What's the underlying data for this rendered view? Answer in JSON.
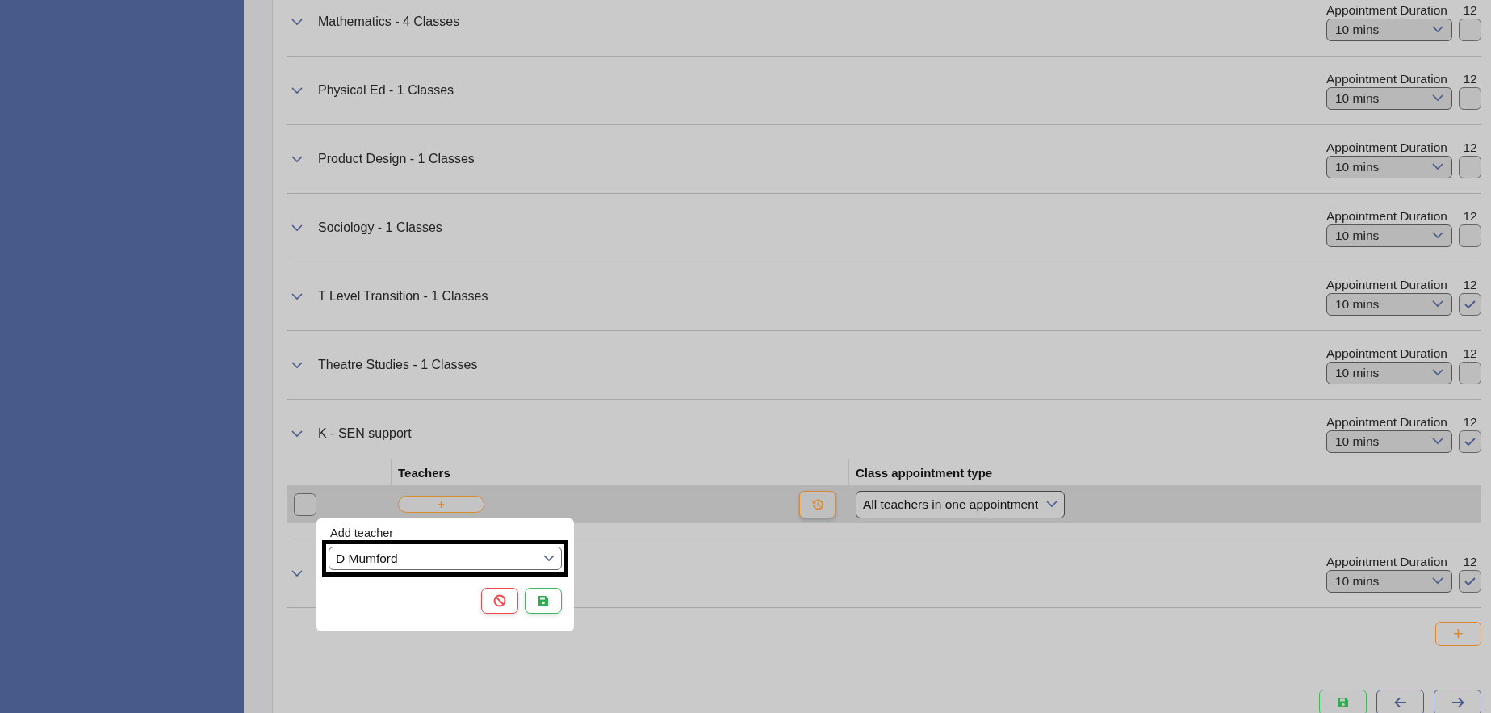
{
  "subjects": [
    {
      "title": "Mathematics - 4 Classes",
      "duration_label": "Appointment Duration",
      "count": "12",
      "duration": "10 mins",
      "checked": false
    },
    {
      "title": "Physical Ed - 1 Classes",
      "duration_label": "Appointment Duration",
      "count": "12",
      "duration": "10 mins",
      "checked": false
    },
    {
      "title": "Product Design - 1 Classes",
      "duration_label": "Appointment Duration",
      "count": "12",
      "duration": "10 mins",
      "checked": false
    },
    {
      "title": "Sociology - 1 Classes",
      "duration_label": "Appointment Duration",
      "count": "12",
      "duration": "10 mins",
      "checked": false
    },
    {
      "title": "T Level Transition - 1 Classes",
      "duration_label": "Appointment Duration",
      "count": "12",
      "duration": "10 mins",
      "checked": true
    },
    {
      "title": "Theatre Studies - 1 Classes",
      "duration_label": "Appointment Duration",
      "count": "12",
      "duration": "10 mins",
      "checked": false
    },
    {
      "title": "K - SEN support",
      "duration_label": "Appointment Duration",
      "count": "12",
      "duration": "10 mins",
      "checked": true,
      "teachers_table": {
        "columns": [
          {
            "label": "Teachers"
          },
          {
            "label": "Class appointment type"
          }
        ],
        "rows": [
          {
            "checked": false,
            "add_label": "+",
            "appointment_type": "All teachers in one appointment"
          }
        ]
      }
    },
    {
      "duration_label": "Appointment Duration",
      "count": "12",
      "duration": "10 mins",
      "checked": true
    }
  ],
  "add_button": "+",
  "popup": {
    "label": "Add teacher",
    "value": "D Mumford"
  }
}
